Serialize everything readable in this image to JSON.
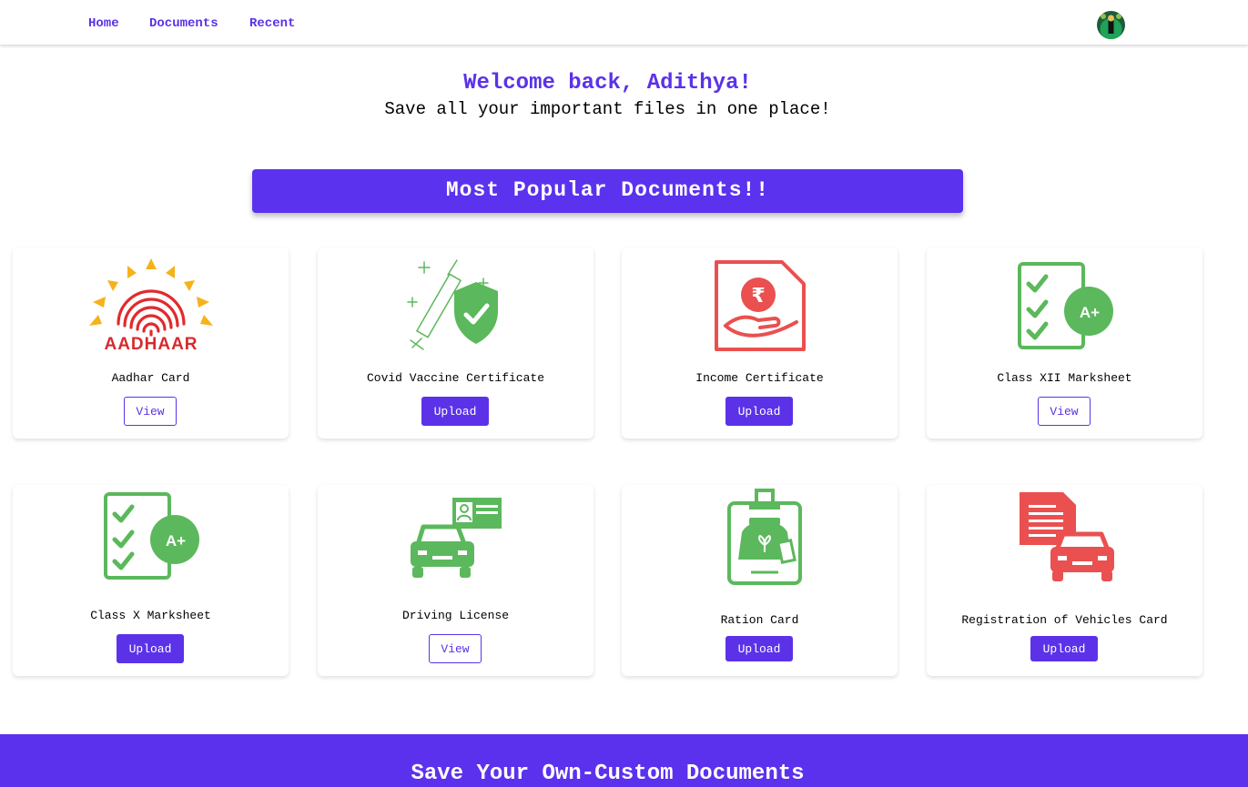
{
  "nav": {
    "home": "Home",
    "documents": "Documents",
    "recent": "Recent"
  },
  "hero": {
    "welcome": "Welcome back, Adithya!",
    "subtitle": "Save all your important files in one place!"
  },
  "banner": {
    "title": "Most Popular Documents!!"
  },
  "cards": [
    {
      "name": "Aadhar Card",
      "button": "View",
      "logo_text": "AADHAAR"
    },
    {
      "name": "Covid Vaccine Certificate",
      "button": "Upload"
    },
    {
      "name": "Income Certificate",
      "button": "Upload",
      "symbol": "₹"
    },
    {
      "name": "Class XII Marksheet",
      "button": "View",
      "grade": "A+"
    },
    {
      "name": "Class X Marksheet",
      "button": "Upload",
      "grade": "A+"
    },
    {
      "name": "Driving License",
      "button": "View"
    },
    {
      "name": "Ration Card",
      "button": "Upload"
    },
    {
      "name": "Registration of Vehicles Card",
      "button": "Upload"
    }
  ],
  "footer": {
    "title": "Save Your Own-Custom Documents"
  },
  "colors": {
    "accent": "#5b32e8",
    "green": "#5cb85c",
    "red": "#e9504f"
  }
}
